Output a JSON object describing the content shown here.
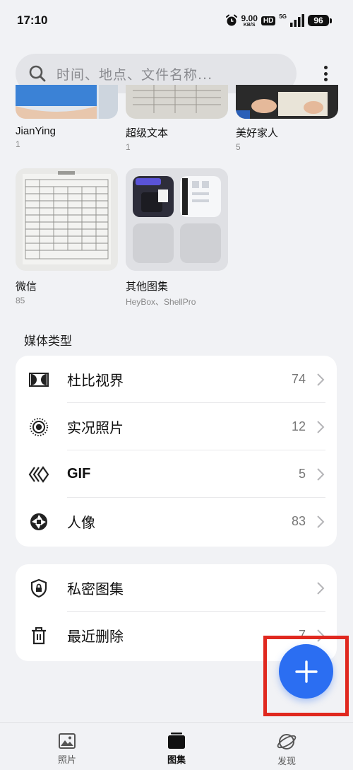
{
  "status": {
    "time": "17:10",
    "speed_value": "9.00",
    "speed_unit": "KB/S",
    "hd": "HD",
    "network": "5G",
    "battery": "96"
  },
  "search": {
    "placeholder": "时间、地点、文件名称..."
  },
  "albums_top": [
    {
      "name": "JianYing",
      "count": "1"
    },
    {
      "name": "超级文本",
      "count": "1"
    },
    {
      "name": "美好家人",
      "count": "5"
    }
  ],
  "albums_mid": [
    {
      "name": "微信",
      "count": "85"
    },
    {
      "name": "其他图集",
      "count": "HeyBox、ShellPro"
    }
  ],
  "media_types": {
    "title": "媒体类型",
    "items": [
      {
        "label": "杜比视界",
        "count": "74",
        "icon": "dolby-vision-icon"
      },
      {
        "label": "实况照片",
        "count": "12",
        "icon": "live-photo-icon"
      },
      {
        "label": "GIF",
        "count": "5",
        "icon": "gif-icon"
      },
      {
        "label": "人像",
        "count": "83",
        "icon": "portrait-aperture-icon"
      }
    ]
  },
  "utility": {
    "items": [
      {
        "label": "私密图集",
        "count": "",
        "icon": "shield-lock-icon"
      },
      {
        "label": "最近删除",
        "count": "7",
        "icon": "trash-icon"
      }
    ]
  },
  "bottom_nav": {
    "items": [
      {
        "label": "照片",
        "icon": "photo-icon",
        "active": false
      },
      {
        "label": "图集",
        "icon": "album-icon",
        "active": true
      },
      {
        "label": "发现",
        "icon": "discover-planet-icon",
        "active": false
      }
    ]
  },
  "colors": {
    "accent": "#2b6ef2",
    "highlight": "#e0281f",
    "background": "#f1f2f5"
  }
}
